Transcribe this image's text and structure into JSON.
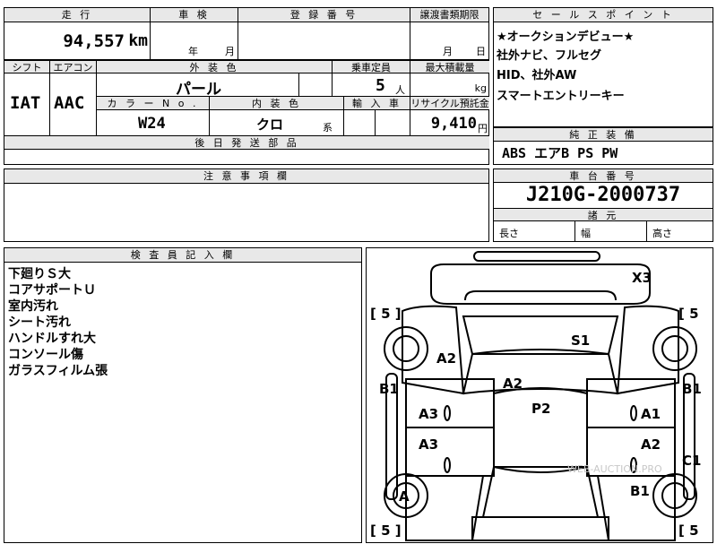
{
  "top": {
    "mileage_header": "走 行",
    "mileage_value": "94,557",
    "mileage_unit": "km",
    "shaken_header": "車 検",
    "shaken_year": "年",
    "shaken_month": "月",
    "reg_header": "登 録 番 号",
    "transfer_header": "譲渡書類期限",
    "transfer_month": "月",
    "transfer_day": "日",
    "shift_header": "シフト",
    "aircon_header": "エアコン",
    "ext_color_header": "外 装 色",
    "capacity_header": "乗車定員",
    "maxload_header": "最大積載量",
    "shift_value": "IAT",
    "aircon_value": "AAC",
    "ext_color_value": "パール",
    "capacity_value": "5",
    "capacity_unit": "人",
    "maxload_unit": "kg",
    "colorno_header": "カ ラ ー N o .",
    "int_color_header": "内 装 色",
    "import_header": "輸 入 車",
    "recycle_header": "リサイクル預託金",
    "colorno_value": "W24",
    "int_color_value": "クロ",
    "int_color_suffix": "系",
    "recycle_value": "9,410",
    "recycle_unit": "円",
    "later_parts_header": "後 日 発 送 部 品"
  },
  "sales_points": {
    "header": "セ ー ル ス ポ イ ン ト",
    "lines": [
      "★オークションデビュー★",
      "社外ナビ、フルセグ",
      "HID、社外AW",
      "スマートエントリーキー"
    ]
  },
  "equipment": {
    "header": "純 正 装 備",
    "value": "ABS エアB PS PW"
  },
  "notes": {
    "header": "注 意 事 項 欄"
  },
  "chassis": {
    "header": "車 台 番 号",
    "value": "J210G-2000737",
    "dims_header": "諸 元",
    "length_label": "長さ",
    "width_label": "幅",
    "height_label": "高さ"
  },
  "inspector": {
    "header": "検 査 員 記 入 欄",
    "lines": [
      "下廻りＳ大",
      "コアサポートＵ",
      "室内汚れ",
      "シート汚れ",
      "ハンドルすれ大",
      "コンソール傷",
      "ガラスフィルム張"
    ]
  },
  "diagram": {
    "marks": {
      "x3": "X3",
      "s1": "S1",
      "a2_hood": "A2",
      "a2_roof": "A2",
      "p2": "P2",
      "b1_left": "B1",
      "b1_right": "B1",
      "a3_front": "A3",
      "a3_rear": "A3",
      "a1": "A1",
      "a2_rear_right": "A2",
      "c1": "C1",
      "a_wheel": "A",
      "b1_rear": "B1"
    },
    "tyre_tl": "5",
    "tyre_tr": "5",
    "tyre_bl": "5",
    "tyre_br": "5",
    "watermark": "WEB-AUCTION.PRO"
  }
}
